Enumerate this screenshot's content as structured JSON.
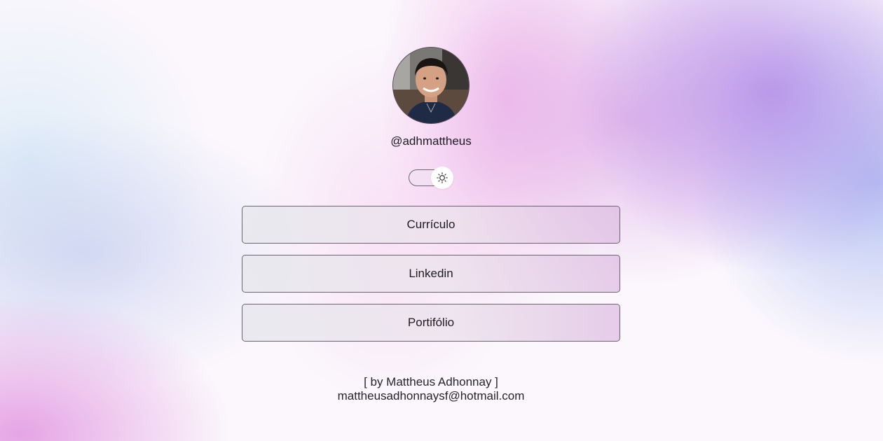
{
  "profile": {
    "avatar_icon": "profile-photo",
    "username": "@adhmattheus"
  },
  "theme_toggle": {
    "icon": "sun-icon",
    "state": "light"
  },
  "links": [
    {
      "label": "Currículo"
    },
    {
      "label": "Linkedin"
    },
    {
      "label": "Portifólio"
    }
  ],
  "footer": {
    "credit": "[ by Mattheus Adhonnay ]",
    "email": "mattheusadhonnaysf@hotmail.com"
  },
  "colors": {
    "text": "#1c1c22",
    "button_border": "#6c6470",
    "accent_purple": "#aa82e6",
    "accent_pink": "#eeaae6",
    "accent_blue": "#a0b4f0"
  }
}
